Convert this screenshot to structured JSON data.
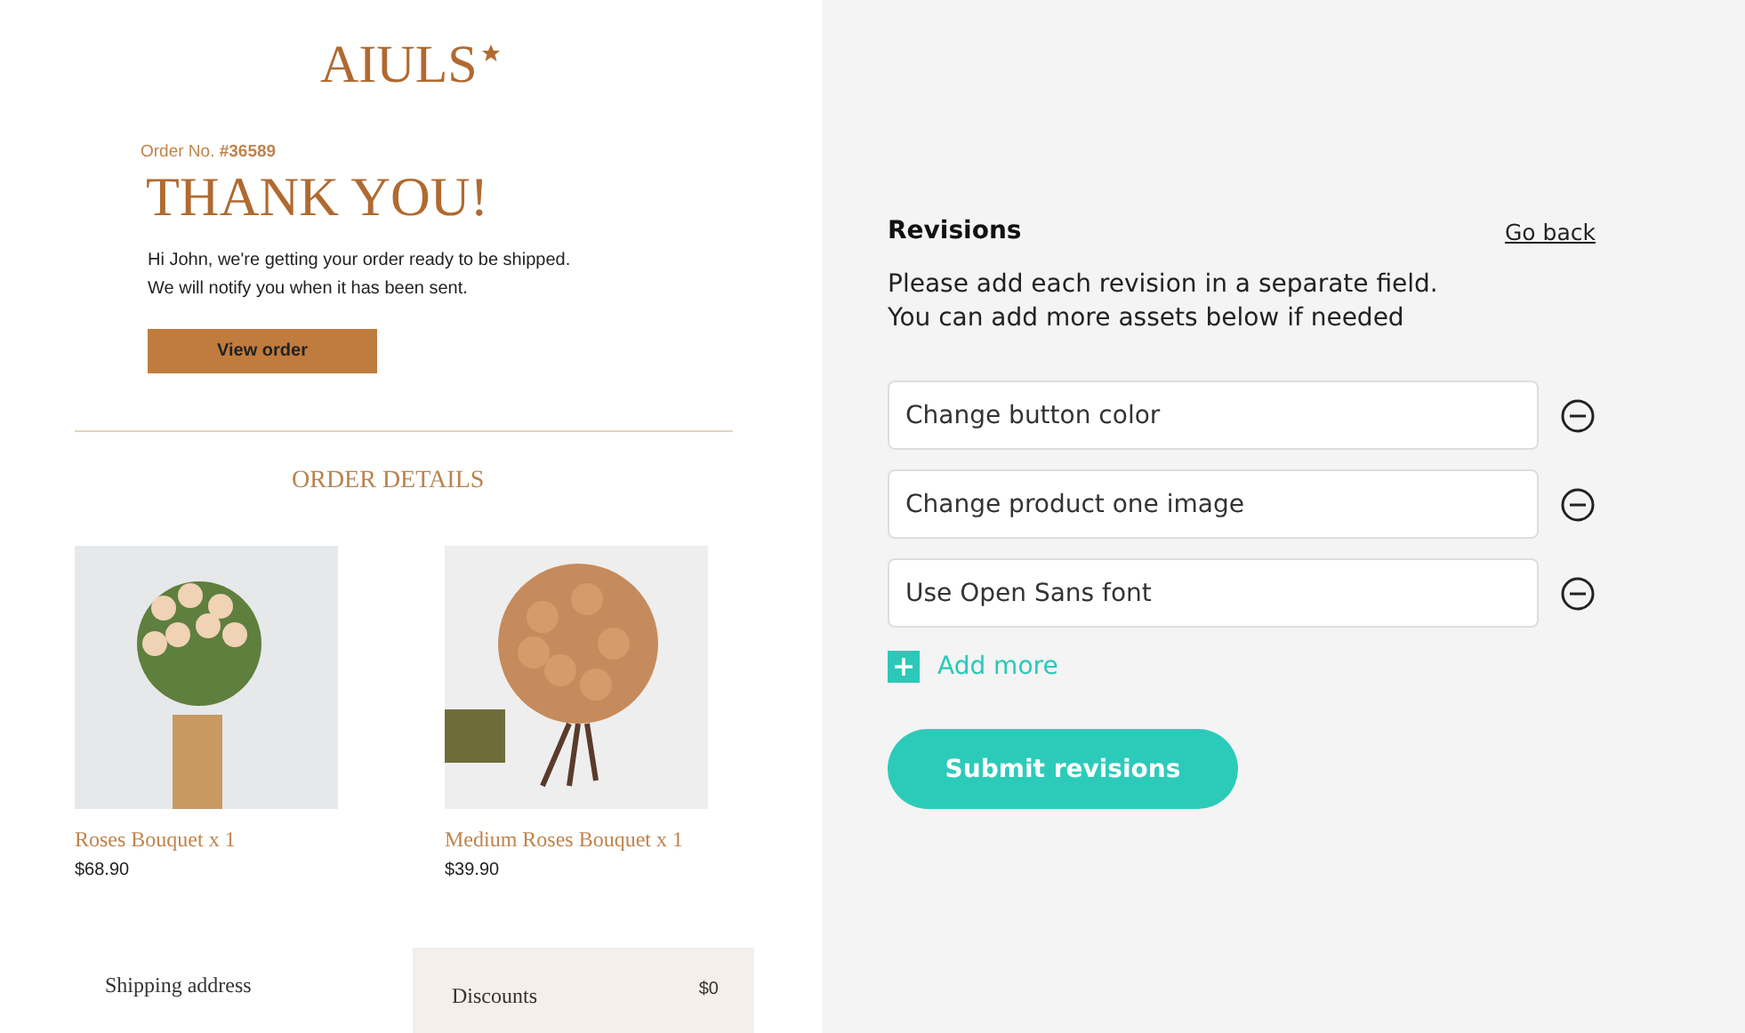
{
  "email": {
    "logo": "AIULS",
    "order_label": "Order No.",
    "order_number": "#36589",
    "heading": "THANK YOU!",
    "message": [
      "Hi John, we're getting your order ready to be shipped.",
      "We will notify you when it has been sent."
    ],
    "button": "View order",
    "section_title": "ORDER DETAILS",
    "products": [
      {
        "name": "Roses Bouquet x 1",
        "price": "$68.90",
        "kind": "vase"
      },
      {
        "name": "Medium Roses Bouquet x 1",
        "price": "$39.90",
        "kind": "hand"
      }
    ],
    "shipping_title": "Shipping address",
    "discounts_label": "Discounts",
    "discounts_value": "$0"
  },
  "revisions": {
    "title": "Revisions",
    "back_link": "Go back",
    "instructions": [
      "Please add each revision in a separate field.",
      "You can add more assets below if needed"
    ],
    "fields": [
      {
        "value": "Change button color"
      },
      {
        "value": "Change product one image"
      },
      {
        "value": "Use Open Sans font"
      }
    ],
    "add_more": "Add more",
    "submit": "Submit revisions"
  }
}
